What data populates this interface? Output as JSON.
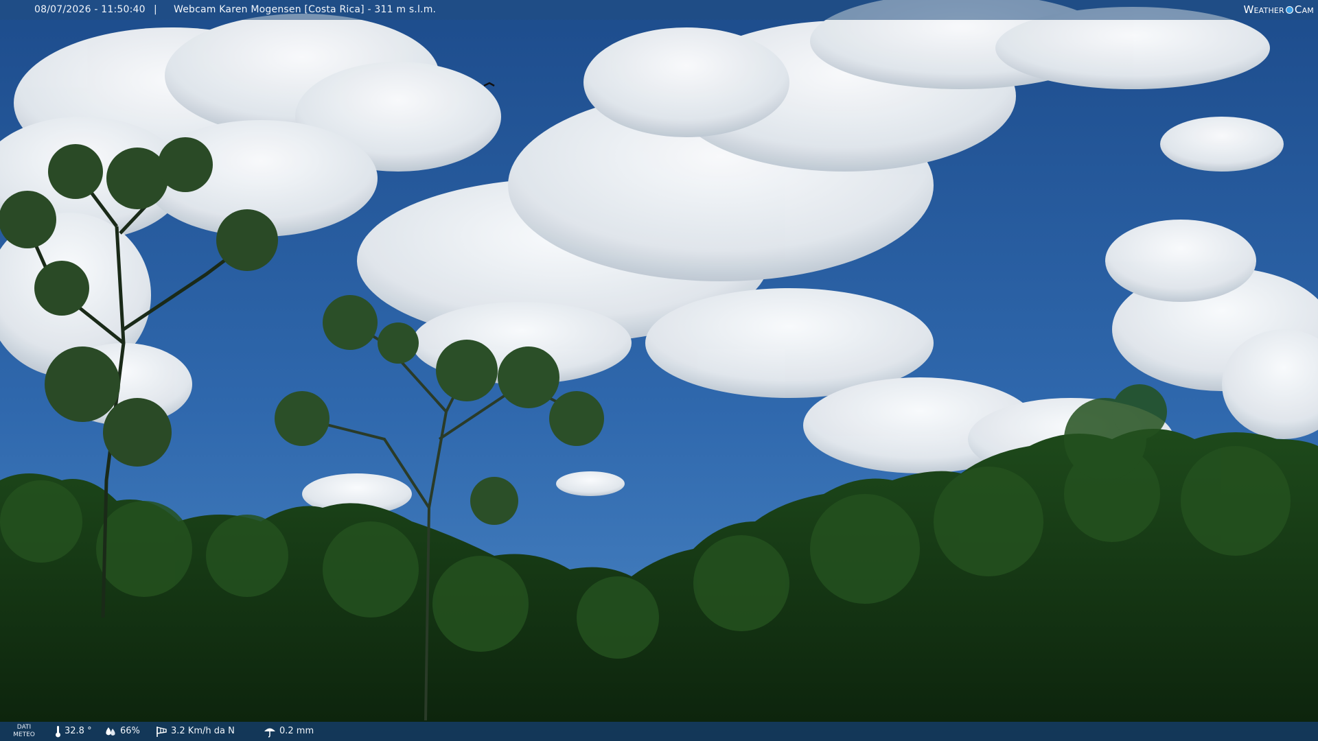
{
  "overlay": {
    "datetime": "08/07/2026 - 11:50:40",
    "separator": "|",
    "title": "Webcam Karen Mogensen [Costa Rica]  - 311 m s.l.m.",
    "brand": {
      "left": "Weather",
      "right": "Cam"
    }
  },
  "meteo": {
    "label_line1": "DATI",
    "label_line2": "METEO",
    "temperature": "32.8 °",
    "humidity": "66%",
    "wind": "3.2 Km/h da N",
    "rain": "0.2 mm",
    "icons": {
      "temperature": "thermometer-icon",
      "humidity": "droplets-icon",
      "wind": "windsock-icon",
      "rain": "umbrella-icon"
    }
  },
  "colors": {
    "sky_top": "#1d4c8c",
    "sky_bottom": "#3f7cc0",
    "cloud": "#f4f6f8",
    "forest_dark": "#0f2a10",
    "forest_mid": "#1f4a1c",
    "bar": "#1c4a80"
  }
}
